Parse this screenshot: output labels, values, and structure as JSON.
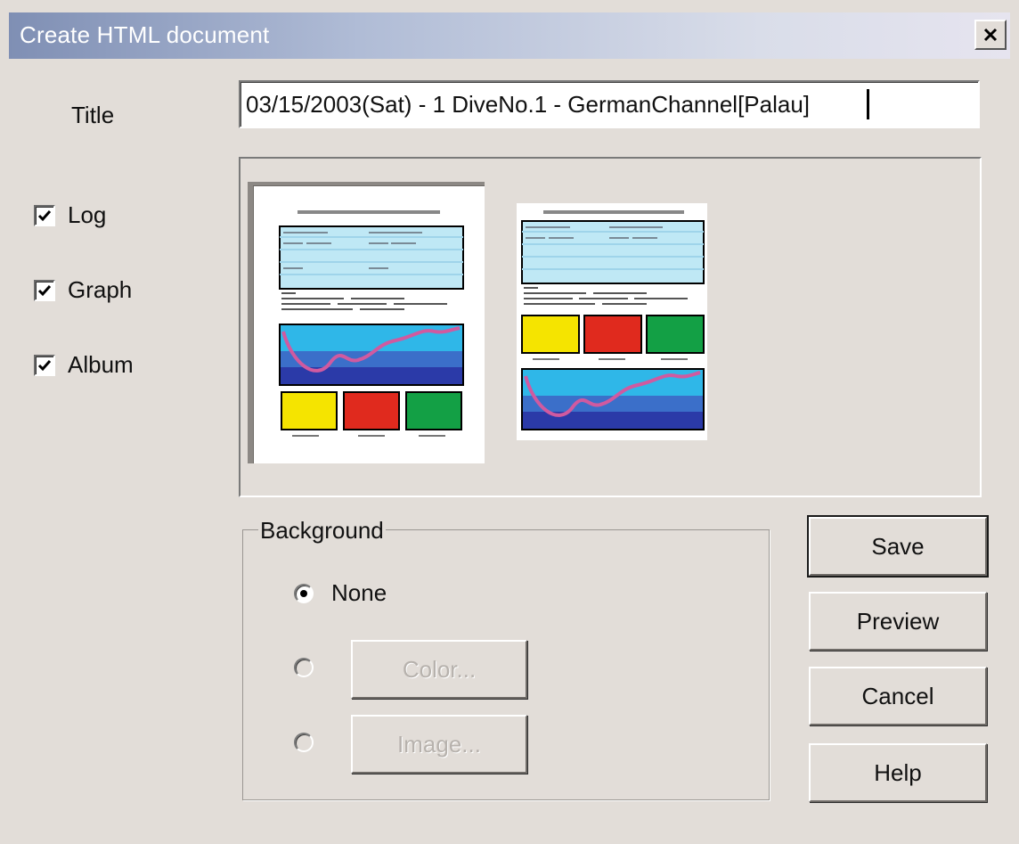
{
  "window": {
    "title": "Create HTML document"
  },
  "title_field": {
    "label": "Title",
    "value": "03/15/2003(Sat) - 1 DiveNo.1 - GermanChannel[Palau]"
  },
  "sections": [
    {
      "label": "Log",
      "checked": true
    },
    {
      "label": "Graph",
      "checked": true
    },
    {
      "label": "Album",
      "checked": true
    }
  ],
  "layouts": {
    "selected_index": 0,
    "count": 2
  },
  "background": {
    "group_label": "Background",
    "options": [
      {
        "label": "None",
        "selected": true,
        "enabled": true
      },
      {
        "label": "Color...",
        "selected": false,
        "enabled": false
      },
      {
        "label": "Image...",
        "selected": false,
        "enabled": false
      }
    ]
  },
  "buttons": {
    "save": "Save",
    "preview": "Preview",
    "cancel": "Cancel",
    "help": "Help"
  },
  "colors": {
    "thumb_yellow": "#f5e400",
    "thumb_red": "#e02a1e",
    "thumb_green": "#13a045",
    "thumb_sea": "#2fb7e8",
    "thumb_deep": "#2b3aa8"
  }
}
